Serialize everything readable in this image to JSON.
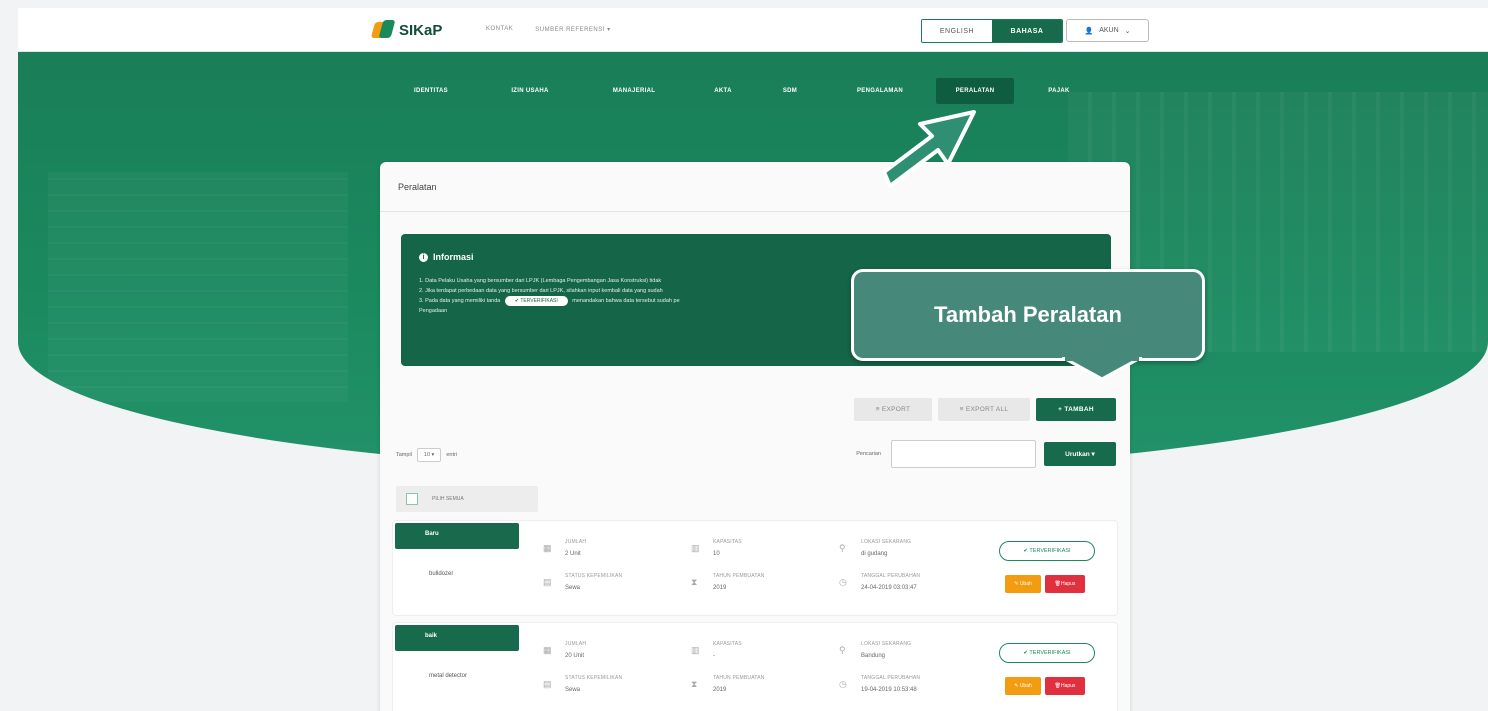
{
  "header": {
    "logo": "SIKaP",
    "nav": [
      "KONTAK",
      "SUMBER REFERENSI ▾"
    ],
    "lang_en": "ENGLISH",
    "lang_id": "BAHASA",
    "account": "AKUN"
  },
  "tabs": [
    {
      "label": "IDENTITAS"
    },
    {
      "label": "IZIN USAHA"
    },
    {
      "label": "MANAJERIAL"
    },
    {
      "label": "AKTA"
    },
    {
      "label": "SDM"
    },
    {
      "label": "PENGALAMAN"
    },
    {
      "label": "PERALATAN",
      "active": true
    },
    {
      "label": "PAJAK"
    }
  ],
  "card": {
    "title": "Peralatan",
    "info": {
      "title": "Informasi",
      "line1": "1. Data Pelaku Usaha yang bersumber dari LPJK (Lembaga Pengembangan Jasa Konstruksi) tidak",
      "line2": "2. Jika terdapat perbedaan data yang bersumber dari LPJK, silahkan input kembali data yang sudah",
      "line3a": "3. Pada data yang memiliki tanda",
      "line3_badge": "✔ TERVERIFIKASI",
      "line3b": "menandakan bahwa data tersebut sudah pe",
      "line4": "Pengadaan"
    },
    "buttons": {
      "export": "≡ EXPORT",
      "export_all": "≡ EXPORT ALL",
      "tambah": "+ TAMBAH"
    },
    "show": {
      "prefix": "Tampil",
      "value": "10 ▾",
      "suffix": "entri"
    },
    "search_label": "Pencarian",
    "sort_button": "Urutkan ▾",
    "select_all": "PILIH SEMUA"
  },
  "rows": [
    {
      "tag": "Baru",
      "name": "bulldozer",
      "jumlah_label": "JUMLAH",
      "jumlah": "2 Unit",
      "kapasitas_label": "KAPASITAS",
      "kapasitas": "10",
      "lokasi_label": "LOKASI SEKARANG",
      "lokasi": "di gudang",
      "status_label": "STATUS KEPEMILIKAN",
      "status": "Sewa",
      "tahun_label": "TAHUN PEMBUATAN",
      "tahun": "2019",
      "tanggal_label": "TANGGAL PERUBAHAN",
      "tanggal": "24-04-2019 03:03:47",
      "badge": "✔ TERVERIFIKASI",
      "ubah": "Ubah",
      "hapus": "Hapus"
    },
    {
      "tag": "baik",
      "name": "metal detector",
      "jumlah_label": "JUMLAH",
      "jumlah": "20 Unit",
      "kapasitas_label": "KAPASITAS",
      "kapasitas": "-",
      "lokasi_label": "LOKASI SEKARANG",
      "lokasi": "Bandung",
      "status_label": "STATUS KEPEMILIKAN",
      "status": "Sewa",
      "tahun_label": "TAHUN PEMBUATAN",
      "tahun": "2019",
      "tanggal_label": "TANGGAL PERUBAHAN",
      "tanggal": "19-04-2019 10:53:48",
      "badge": "✔ TERVERIFIKASI",
      "ubah": "Ubah",
      "hapus": "Hapus"
    }
  ],
  "callout": {
    "text": "Tambah Peralatan"
  },
  "colors": {
    "primary": "#176a4c",
    "hero": "#1b8a5f",
    "callout": "#46897a",
    "edit": "#f39c12",
    "delete": "#e0303e"
  }
}
